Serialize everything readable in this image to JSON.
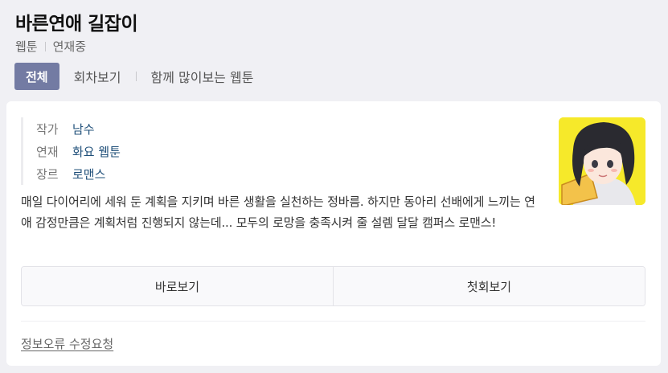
{
  "title": "바른연애 길잡이",
  "meta": {
    "type": "웹툰",
    "status": "연재중"
  },
  "tabs": [
    {
      "label": "전체",
      "active": true
    },
    {
      "label": "회차보기",
      "active": false
    },
    {
      "label": "함께 많이보는 웹툰",
      "active": false
    }
  ],
  "info": {
    "author_label": "작가",
    "author": "남수",
    "serial_label": "연재",
    "serial": "화요 웹툰",
    "genre_label": "장르",
    "genre": "로맨스"
  },
  "description": "매일 다이어리에 세워 둔 계획을 지키며 바른 생활을 실천하는 정바름. 하지만 동아리 선배에게 느끼는 연애 감정만큼은 계획처럼 진행되지 않는데... 모두의 로망을 충족시켜 줄 설렘 달달 캠퍼스 로맨스!",
  "buttons": {
    "read_now": "바로보기",
    "first_episode": "첫회보기"
  },
  "report_link": "정보오류 수정요청",
  "colors": {
    "accent": "#737ba3",
    "link": "#20507a",
    "background": "#f0f0f4"
  },
  "icons": {
    "thumbnail": "webtoon-cover-thumbnail"
  }
}
